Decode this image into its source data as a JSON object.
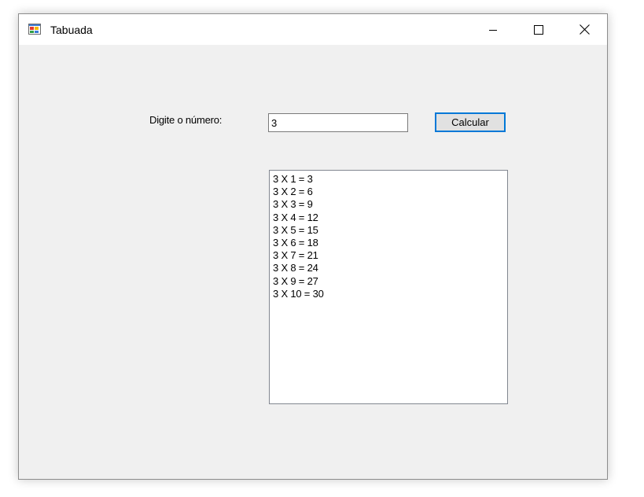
{
  "window": {
    "title": "Tabuada",
    "icon": "winforms-app-icon",
    "controls": {
      "minimize_icon": "minimize-icon",
      "maximize_icon": "maximize-icon",
      "close_icon": "close-icon"
    }
  },
  "form": {
    "prompt_label": "Digite o número:",
    "number_value": "3",
    "calculate_label": "Calcular"
  },
  "results": [
    "3 X 1 = 3",
    "3 X 2 = 6",
    "3 X 3 = 9",
    "3 X 4 = 12",
    "3 X 5 = 15",
    "3 X 6 = 18",
    "3 X 7 = 21",
    "3 X 8 = 24",
    "3 X 9 = 27",
    "3 X 10 = 30"
  ],
  "colors": {
    "focus_border": "#0078d7",
    "window_background": "#f0f0f0"
  }
}
